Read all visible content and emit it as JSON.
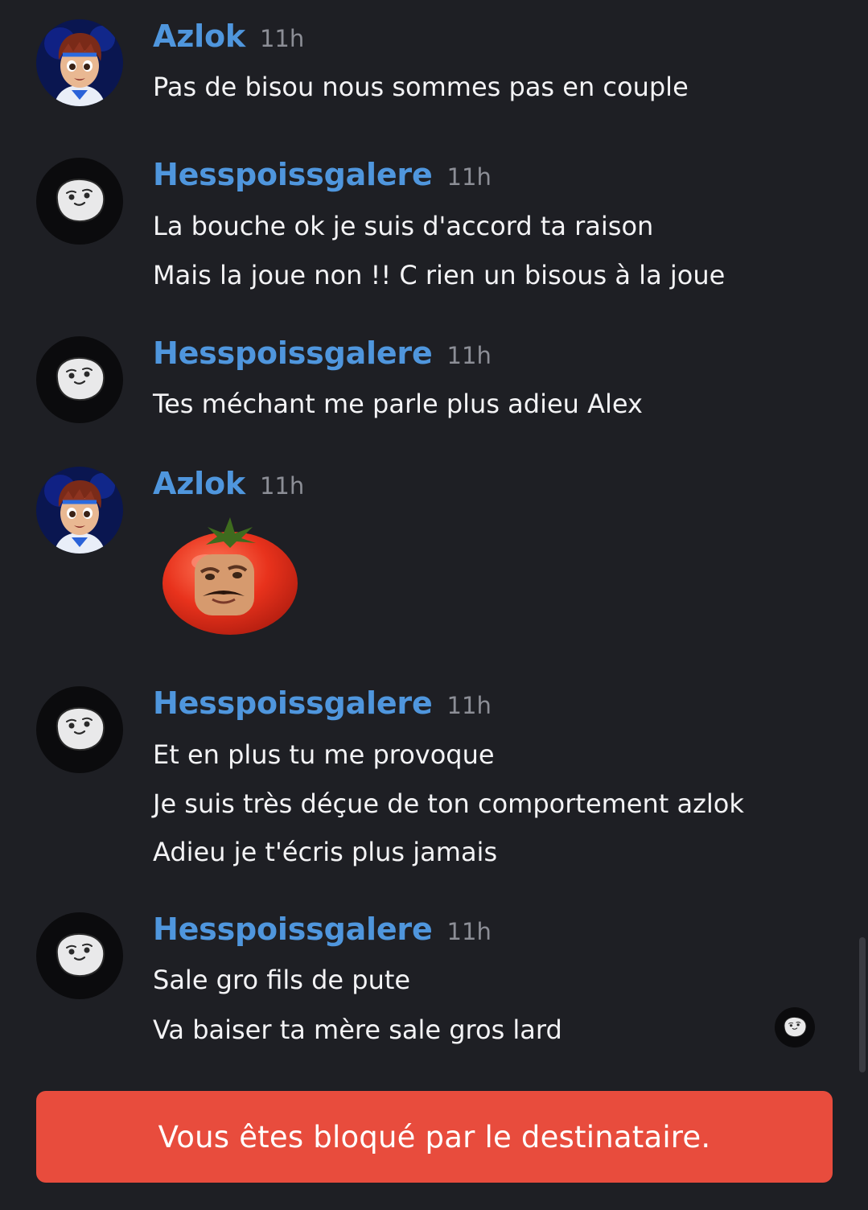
{
  "messages": [
    {
      "author": "Azlok",
      "time": "11h",
      "avatar_icon": "anime-boy-avatar-icon",
      "lines": [
        "Pas de bisou nous sommes pas en couple"
      ]
    },
    {
      "author": "Hesspoissgalere",
      "time": "11h",
      "avatar_icon": "white-blob-face-avatar-icon",
      "lines": [
        "La bouche ok je suis d'accord ta raison",
        "Mais la joue non !! C rien un bisous à la joue"
      ]
    },
    {
      "author": "Hesspoissgalere",
      "time": "11h",
      "avatar_icon": "white-blob-face-avatar-icon",
      "lines": [
        "Tes méchant me parle plus adieu Alex"
      ]
    },
    {
      "author": "Azlok",
      "time": "11h",
      "avatar_icon": "anime-boy-avatar-icon",
      "sticker": "tomato-face-sticker"
    },
    {
      "author": "Hesspoissgalere",
      "time": "11h",
      "avatar_icon": "white-blob-face-avatar-icon",
      "lines": [
        "Et en plus tu me provoque",
        "Je suis très déçue de ton comportement azlok",
        "Adieu je t'écris plus jamais"
      ]
    },
    {
      "author": "Hesspoissgalere",
      "time": "11h",
      "avatar_icon": "white-blob-face-avatar-icon",
      "lines": [
        "Sale gro fils de pute",
        "Va baiser ta mère sale gros lard"
      ]
    }
  ],
  "blocked_banner": {
    "text": "Vous êtes bloqué par le destinataire."
  },
  "colors": {
    "background": "#1e1f24",
    "username": "#4f96dd",
    "timestamp": "#8c8e96",
    "banner": "#e84c3d"
  }
}
